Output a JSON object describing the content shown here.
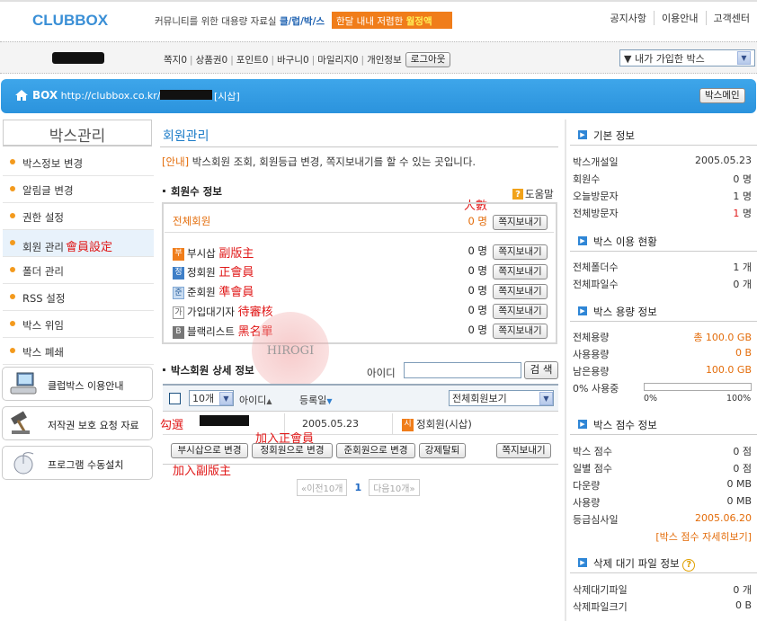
{
  "header": {
    "logo": "CLUBBOX",
    "tagline_prefix": "커뮤니티를 위한 대용량 자료실",
    "tagline_brand": "클/럽/박/스",
    "promo_text": "한달 내내 저렴한",
    "promo_bold": "월정액",
    "nav": [
      "공지사항",
      "이용안내",
      "고객센터"
    ]
  },
  "userbar": {
    "links": [
      {
        "label": "쪽지",
        "count": "0"
      },
      {
        "label": "상품권",
        "count": "0"
      },
      {
        "label": "포인트",
        "count": "0"
      },
      {
        "label": "바구니",
        "count": "0"
      },
      {
        "label": "마일리지",
        "count": "0"
      }
    ],
    "personal": "개인정보",
    "logout": "로그아웃",
    "joined_select": "▼ 내가 가입한 박스"
  },
  "boxbar": {
    "label": "BOX",
    "url": "http://clubbox.co.kr/",
    "tag": "[시삽]",
    "main_button": "박스메인"
  },
  "sidebar": {
    "title": "박스관리",
    "items": [
      {
        "label": "박스정보 변경",
        "active": false
      },
      {
        "label": "알림글 변경",
        "active": false
      },
      {
        "label": "권한 설정",
        "active": false
      },
      {
        "label": "회원 관리",
        "active": true,
        "note": "會員設定"
      },
      {
        "label": "폴더 관리",
        "active": false
      },
      {
        "label": "RSS 설정",
        "active": false
      },
      {
        "label": "박스 위임",
        "active": false
      },
      {
        "label": "박스 폐쇄",
        "active": false
      }
    ],
    "boxes": [
      {
        "label": "클럽박스 이용안내",
        "icon": "computer-icon"
      },
      {
        "label": "저작권 보호 요청 자료",
        "icon": "gavel-icon"
      },
      {
        "label": "프로그램 수동설치",
        "icon": "mouse-icon"
      }
    ]
  },
  "main": {
    "title": "회원관리",
    "intro_tag": "[안내]",
    "intro_text": "박스회원 조회, 회원등급 변경, 쪽지보내기를 할 수 있는 곳입니다.",
    "count_section": "회원수 정보",
    "help": "도움말",
    "count_note": "人數",
    "all": {
      "label": "전체회원",
      "count": "0 명",
      "button": "쪽지보내기"
    },
    "grades": [
      {
        "badge": "부",
        "label": "부시삽",
        "count": "0 명",
        "button": "쪽지보내기",
        "note": "副版主",
        "color": "#f07d1a"
      },
      {
        "badge": "정",
        "label": "정회원",
        "count": "0 명",
        "button": "쪽지보내기",
        "note": "正會員",
        "color": "#3f7fc7"
      },
      {
        "badge": "준",
        "label": "준회원",
        "count": "0 명",
        "button": "쪽지보내기",
        "note": "準會員",
        "color": "#8fb2d9"
      },
      {
        "badge": "가",
        "label": "가입대기자",
        "count": "0 명",
        "button": "쪽지보내기",
        "note": "待審核",
        "color": "#ffffff"
      },
      {
        "badge": "B",
        "label": "블랙리스트",
        "count": "0 명",
        "button": "쪽지보내기",
        "note": "黑名單",
        "color": "#777777"
      }
    ],
    "watermark": "HIROGI",
    "detail_section": "박스회원 상세 정보",
    "id_label": "아이디",
    "search_button": "검 색",
    "table": {
      "per_page": "10개",
      "col_id": "아이디",
      "col_date": "등록일",
      "filter": "전체회원보기",
      "rows": [
        {
          "date": "2005.05.23",
          "grade_badge": "시",
          "grade": "정회원(시삽)"
        }
      ]
    },
    "notes": {
      "check": "勾選",
      "add_regular": "加入正會員",
      "add_sub": "加入副版主"
    },
    "actions": [
      "부시삽으로 변경",
      "정회원으로 변경",
      "준회원으로 변경",
      "강제탈퇴"
    ],
    "send_button": "쪽지보내기",
    "pager": {
      "prev": "이전10개",
      "current": "1",
      "next": "다음10개"
    }
  },
  "right": {
    "basic": {
      "title": "기본 정보",
      "rows": [
        {
          "label": "박스개설일",
          "value": "2005.05.23"
        },
        {
          "label": "회원수",
          "value": "0 명"
        },
        {
          "label": "오늘방문자",
          "value": "1 명"
        },
        {
          "label": "전체방문자",
          "value_red": "1",
          "value": " 명"
        }
      ]
    },
    "usage": {
      "title": "박스 이용 현황",
      "rows": [
        {
          "label": "전체폴더수",
          "value": "1 개"
        },
        {
          "label": "전체파일수",
          "value": "0 개"
        }
      ]
    },
    "capacity": {
      "title": "박스 용량 정보",
      "total_label": "전체용량",
      "total_value": "총 100.0 GB",
      "used_label": "사용용량",
      "used_value": "0 B",
      "remain_label": "남은용량",
      "remain_value": "100.0 GB",
      "percent_label": "0% 사용중",
      "percent_value": 0,
      "scale_min": "0%",
      "scale_max": "100%"
    },
    "score": {
      "title": "박스 점수 정보",
      "rows": [
        {
          "label": "박스 점수",
          "value": "0 점"
        },
        {
          "label": "일별 점수",
          "value": "0 점"
        },
        {
          "label": "다운량",
          "value": "0 MB"
        },
        {
          "label": "사용량",
          "value": "0 MB"
        },
        {
          "label": "등급심사일",
          "value": "2005.06.20"
        }
      ],
      "link": "[박스 점수 자세히보기]"
    },
    "deletion": {
      "title": "삭제 대기 파일 정보",
      "rows": [
        {
          "label": "삭제대기파일",
          "value": "0 개"
        },
        {
          "label": "삭제파일크기",
          "value": "0 B"
        }
      ]
    }
  }
}
